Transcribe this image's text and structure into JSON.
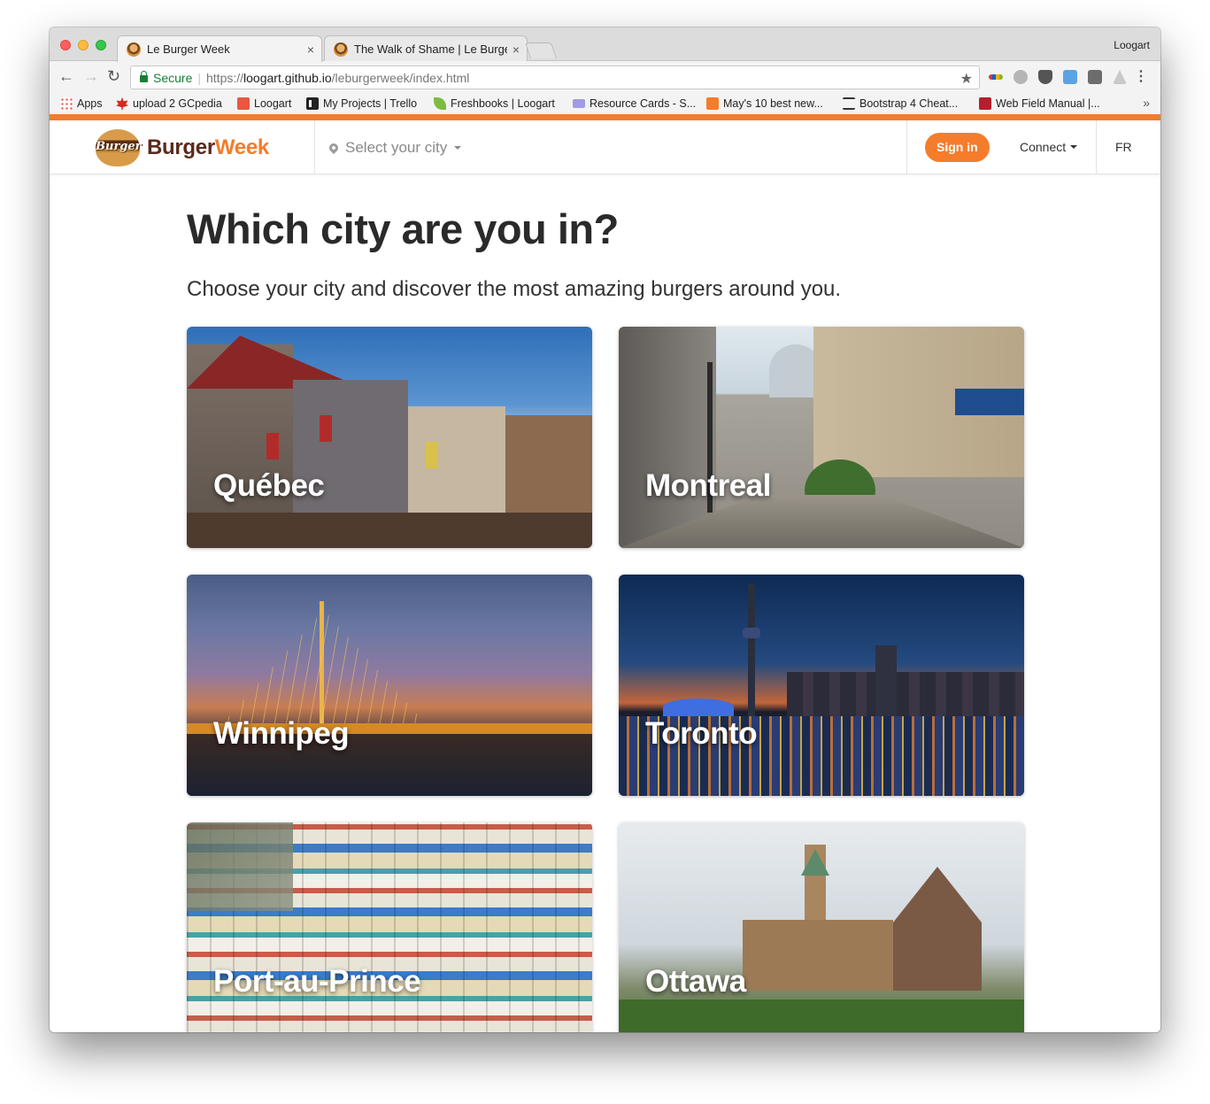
{
  "browser": {
    "tabs": [
      {
        "title": "Le Burger Week",
        "close": "×",
        "active": true
      },
      {
        "title": "The Walk of Shame | Le Burger",
        "close": "×",
        "active": false
      }
    ],
    "profile_name": "Loogart",
    "nav": {
      "back": "←",
      "forward": "→",
      "reload": "↻"
    },
    "address": {
      "secure_label": "Secure",
      "separator": "|",
      "scheme": "https://",
      "host": "loogart.github.io",
      "path": "/leburgerweek/index.html"
    },
    "star_icon": "★",
    "menu_icon": "⋮",
    "bookmarks": [
      {
        "label": "Apps",
        "icon": "apps-grid-icon",
        "color": "#e94235"
      },
      {
        "label": "upload 2 GCpedia",
        "icon": "maple-leaf-icon",
        "color": "#d52b1e"
      },
      {
        "label": "Loogart",
        "icon": "loogart-icon",
        "color": "#e9573f"
      },
      {
        "label": "My Projects | Trello",
        "icon": "trello-icon",
        "color": "#222222"
      },
      {
        "label": "Freshbooks | Loogart",
        "icon": "freshbooks-leaf-icon",
        "color": "#7dbb41"
      },
      {
        "label": "Resource Cards - S...",
        "icon": "resource-cards-icon",
        "color": "#a39ae6"
      },
      {
        "label": "May's 10 best new...",
        "icon": "cb-icon",
        "color": "#f57c2b"
      },
      {
        "label": "Bootstrap 4 Cheat...",
        "icon": "ht-icon",
        "color": "#333333"
      },
      {
        "label": "Web Field Manual |...",
        "icon": "web-field-manual-icon",
        "color": "#b3202c"
      }
    ],
    "bookmarks_more": "»"
  },
  "site": {
    "brand": {
      "logo_badge_text": "Burger",
      "name_part1": "Burger",
      "name_part2": "Week"
    },
    "city_select": "Select your city",
    "signin": "Sign in",
    "connect": "Connect",
    "language": "FR",
    "accent_color": "#f57c2b"
  },
  "main": {
    "title": "Which city are you in?",
    "subtitle": "Choose your city and discover the most amazing burgers around you.",
    "cities": [
      {
        "name": "Québec"
      },
      {
        "name": "Montreal"
      },
      {
        "name": "Winnipeg"
      },
      {
        "name": "Toronto"
      },
      {
        "name": "Port-au-Prince"
      },
      {
        "name": "Ottawa"
      }
    ]
  }
}
